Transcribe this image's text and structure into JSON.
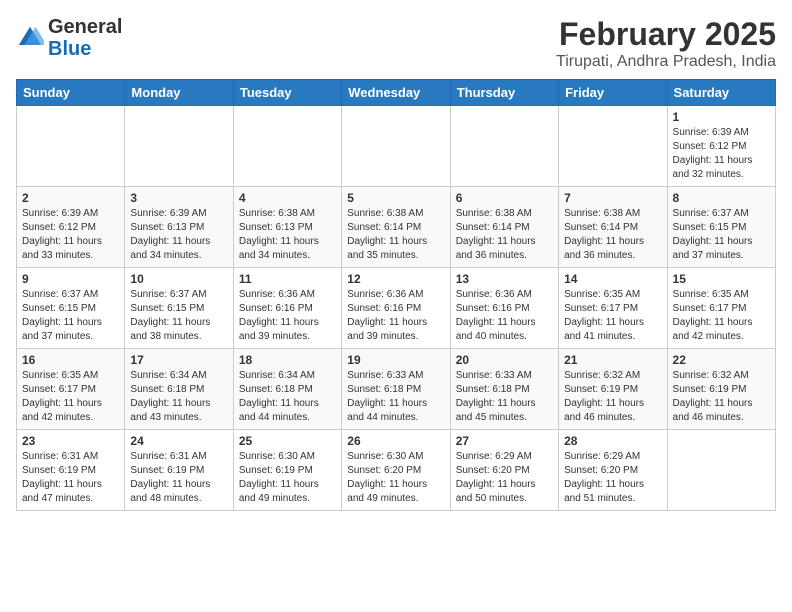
{
  "header": {
    "logo": {
      "general": "General",
      "blue": "Blue"
    },
    "title": "February 2025",
    "location": "Tirupati, Andhra Pradesh, India"
  },
  "weekdays": [
    "Sunday",
    "Monday",
    "Tuesday",
    "Wednesday",
    "Thursday",
    "Friday",
    "Saturday"
  ],
  "weeks": [
    [
      {
        "day": "",
        "info": ""
      },
      {
        "day": "",
        "info": ""
      },
      {
        "day": "",
        "info": ""
      },
      {
        "day": "",
        "info": ""
      },
      {
        "day": "",
        "info": ""
      },
      {
        "day": "",
        "info": ""
      },
      {
        "day": "1",
        "info": "Sunrise: 6:39 AM\nSunset: 6:12 PM\nDaylight: 11 hours\nand 32 minutes."
      }
    ],
    [
      {
        "day": "2",
        "info": "Sunrise: 6:39 AM\nSunset: 6:12 PM\nDaylight: 11 hours\nand 33 minutes."
      },
      {
        "day": "3",
        "info": "Sunrise: 6:39 AM\nSunset: 6:13 PM\nDaylight: 11 hours\nand 34 minutes."
      },
      {
        "day": "4",
        "info": "Sunrise: 6:38 AM\nSunset: 6:13 PM\nDaylight: 11 hours\nand 34 minutes."
      },
      {
        "day": "5",
        "info": "Sunrise: 6:38 AM\nSunset: 6:14 PM\nDaylight: 11 hours\nand 35 minutes."
      },
      {
        "day": "6",
        "info": "Sunrise: 6:38 AM\nSunset: 6:14 PM\nDaylight: 11 hours\nand 36 minutes."
      },
      {
        "day": "7",
        "info": "Sunrise: 6:38 AM\nSunset: 6:14 PM\nDaylight: 11 hours\nand 36 minutes."
      },
      {
        "day": "8",
        "info": "Sunrise: 6:37 AM\nSunset: 6:15 PM\nDaylight: 11 hours\nand 37 minutes."
      }
    ],
    [
      {
        "day": "9",
        "info": "Sunrise: 6:37 AM\nSunset: 6:15 PM\nDaylight: 11 hours\nand 37 minutes."
      },
      {
        "day": "10",
        "info": "Sunrise: 6:37 AM\nSunset: 6:15 PM\nDaylight: 11 hours\nand 38 minutes."
      },
      {
        "day": "11",
        "info": "Sunrise: 6:36 AM\nSunset: 6:16 PM\nDaylight: 11 hours\nand 39 minutes."
      },
      {
        "day": "12",
        "info": "Sunrise: 6:36 AM\nSunset: 6:16 PM\nDaylight: 11 hours\nand 39 minutes."
      },
      {
        "day": "13",
        "info": "Sunrise: 6:36 AM\nSunset: 6:16 PM\nDaylight: 11 hours\nand 40 minutes."
      },
      {
        "day": "14",
        "info": "Sunrise: 6:35 AM\nSunset: 6:17 PM\nDaylight: 11 hours\nand 41 minutes."
      },
      {
        "day": "15",
        "info": "Sunrise: 6:35 AM\nSunset: 6:17 PM\nDaylight: 11 hours\nand 42 minutes."
      }
    ],
    [
      {
        "day": "16",
        "info": "Sunrise: 6:35 AM\nSunset: 6:17 PM\nDaylight: 11 hours\nand 42 minutes."
      },
      {
        "day": "17",
        "info": "Sunrise: 6:34 AM\nSunset: 6:18 PM\nDaylight: 11 hours\nand 43 minutes."
      },
      {
        "day": "18",
        "info": "Sunrise: 6:34 AM\nSunset: 6:18 PM\nDaylight: 11 hours\nand 44 minutes."
      },
      {
        "day": "19",
        "info": "Sunrise: 6:33 AM\nSunset: 6:18 PM\nDaylight: 11 hours\nand 44 minutes."
      },
      {
        "day": "20",
        "info": "Sunrise: 6:33 AM\nSunset: 6:18 PM\nDaylight: 11 hours\nand 45 minutes."
      },
      {
        "day": "21",
        "info": "Sunrise: 6:32 AM\nSunset: 6:19 PM\nDaylight: 11 hours\nand 46 minutes."
      },
      {
        "day": "22",
        "info": "Sunrise: 6:32 AM\nSunset: 6:19 PM\nDaylight: 11 hours\nand 46 minutes."
      }
    ],
    [
      {
        "day": "23",
        "info": "Sunrise: 6:31 AM\nSunset: 6:19 PM\nDaylight: 11 hours\nand 47 minutes."
      },
      {
        "day": "24",
        "info": "Sunrise: 6:31 AM\nSunset: 6:19 PM\nDaylight: 11 hours\nand 48 minutes."
      },
      {
        "day": "25",
        "info": "Sunrise: 6:30 AM\nSunset: 6:19 PM\nDaylight: 11 hours\nand 49 minutes."
      },
      {
        "day": "26",
        "info": "Sunrise: 6:30 AM\nSunset: 6:20 PM\nDaylight: 11 hours\nand 49 minutes."
      },
      {
        "day": "27",
        "info": "Sunrise: 6:29 AM\nSunset: 6:20 PM\nDaylight: 11 hours\nand 50 minutes."
      },
      {
        "day": "28",
        "info": "Sunrise: 6:29 AM\nSunset: 6:20 PM\nDaylight: 11 hours\nand 51 minutes."
      },
      {
        "day": "",
        "info": ""
      }
    ]
  ]
}
